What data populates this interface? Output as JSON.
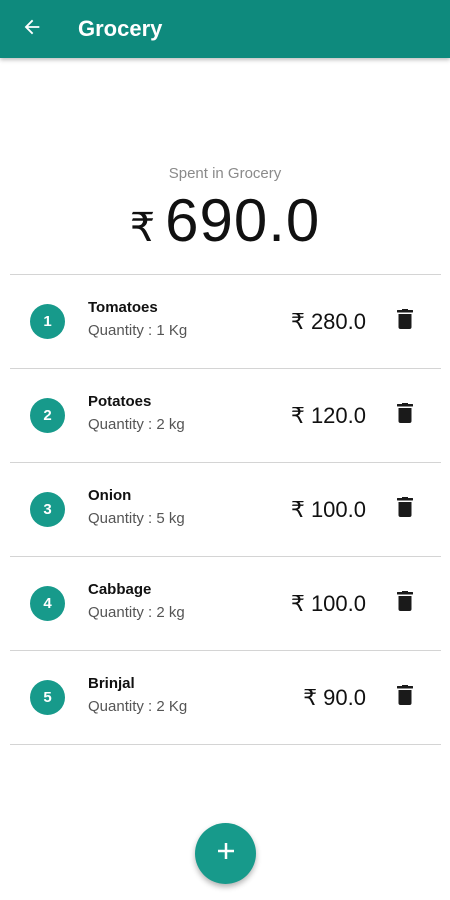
{
  "appbar": {
    "title": "Grocery",
    "back_icon": "arrow-left-icon",
    "color": "#0e8a7d"
  },
  "summary": {
    "label": "Spent in Grocery",
    "currency": "₹",
    "amount": "690.0"
  },
  "items": [
    {
      "index": "1",
      "name": "Tomatoes",
      "quantity": "Quantity : 1 Kg",
      "price": "₹ 280.0"
    },
    {
      "index": "2",
      "name": "Potatoes",
      "quantity": "Quantity : 2 kg",
      "price": "₹ 120.0"
    },
    {
      "index": "3",
      "name": "Onion",
      "quantity": "Quantity : 5 kg",
      "price": "₹ 100.0"
    },
    {
      "index": "4",
      "name": "Cabbage",
      "quantity": "Quantity : 2 kg",
      "price": "₹ 100.0"
    },
    {
      "index": "5",
      "name": "Brinjal",
      "quantity": "Quantity : 2 Kg",
      "price": "₹ 90.0"
    }
  ],
  "fab": {
    "icon": "plus-icon",
    "color": "#179a8b"
  }
}
